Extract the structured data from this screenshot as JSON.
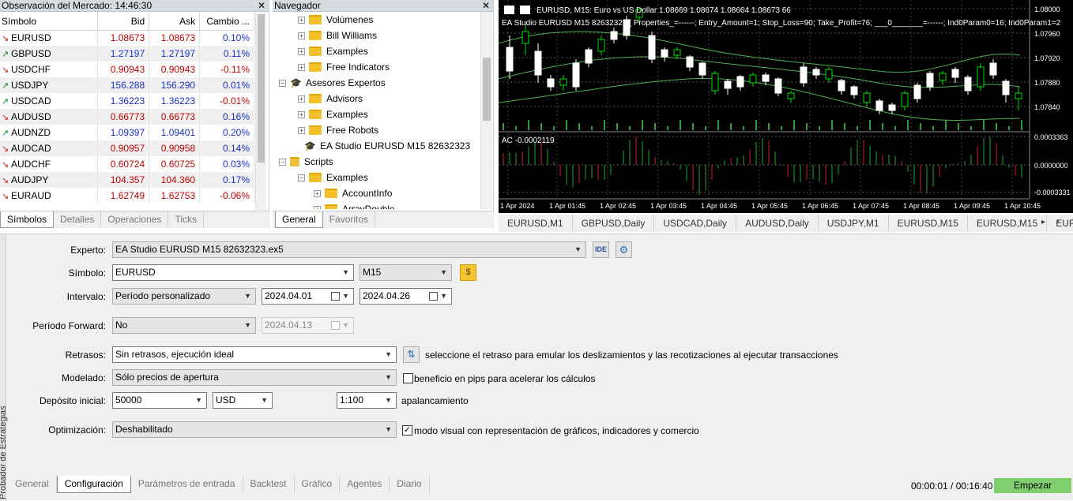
{
  "market_watch": {
    "title": "Observación del Mercado: 14:46:30",
    "columns": [
      "Símbolo",
      "Bid",
      "Ask",
      "Cambio ..."
    ],
    "rows": [
      {
        "symbol": "EURUSD",
        "bid": "1.08673",
        "ask": "1.08673",
        "change": "0.10%",
        "dir": "down"
      },
      {
        "symbol": "GBPUSD",
        "bid": "1.27197",
        "ask": "1.27197",
        "change": "0.11%",
        "dir": "up"
      },
      {
        "symbol": "USDCHF",
        "bid": "0.90943",
        "ask": "0.90943",
        "change": "-0.11%",
        "dir": "down"
      },
      {
        "symbol": "USDJPY",
        "bid": "156.288",
        "ask": "156.290",
        "change": "0.01%",
        "dir": "up"
      },
      {
        "symbol": "USDCAD",
        "bid": "1.36223",
        "ask": "1.36223",
        "change": "-0.01%",
        "dir": "up"
      },
      {
        "symbol": "AUDUSD",
        "bid": "0.66773",
        "ask": "0.66773",
        "change": "0.16%",
        "dir": "down"
      },
      {
        "symbol": "AUDNZD",
        "bid": "1.09397",
        "ask": "1.09401",
        "change": "0.20%",
        "dir": "up"
      },
      {
        "symbol": "AUDCAD",
        "bid": "0.90957",
        "ask": "0.90958",
        "change": "0.14%",
        "dir": "down"
      },
      {
        "symbol": "AUDCHF",
        "bid": "0.60724",
        "ask": "0.60725",
        "change": "0.03%",
        "dir": "down"
      },
      {
        "symbol": "AUDJPY",
        "bid": "104.357",
        "ask": "104.360",
        "change": "0.17%",
        "dir": "down"
      },
      {
        "symbol": "EURAUD",
        "bid": "1.62749",
        "ask": "1.62753",
        "change": "-0.06%",
        "dir": "down"
      }
    ],
    "tabs": [
      "Símbolos",
      "Detalles",
      "Operaciones",
      "Ticks"
    ]
  },
  "navigator": {
    "title": "Navegador",
    "items": [
      {
        "label": "Volúmenes",
        "icon": "folder-icon",
        "toggle": "+"
      },
      {
        "label": "Bill Williams",
        "icon": "folder-icon",
        "toggle": "+"
      },
      {
        "label": "Examples",
        "icon": "folder-icon",
        "toggle": "+"
      },
      {
        "label": "Free Indicators",
        "icon": "folder-icon",
        "toggle": "+"
      },
      {
        "label": "Asesores Expertos",
        "icon": "graduation-cap-icon",
        "toggle": "-"
      },
      {
        "label": "Advisors",
        "icon": "folder-icon",
        "toggle": "+"
      },
      {
        "label": "Examples",
        "icon": "folder-icon",
        "toggle": "+"
      },
      {
        "label": "Free Robots",
        "icon": "folder-icon",
        "toggle": "+"
      },
      {
        "label": "EA Studio EURUSD M15 82632323",
        "icon": "graduation-cap-icon",
        "toggle": ""
      },
      {
        "label": "Scripts",
        "icon": "script-icon",
        "toggle": "-"
      },
      {
        "label": "Examples",
        "icon": "folder-icon",
        "toggle": "-"
      },
      {
        "label": "AccountInfo",
        "icon": "folder-icon",
        "toggle": "+"
      },
      {
        "label": "ArrayDouble",
        "icon": "folder-icon",
        "toggle": "+"
      }
    ],
    "tabs": [
      "General",
      "Favoritos"
    ]
  },
  "chart": {
    "header": "EURUSD, M15:  Euro vs US Dollar  1.08669 1.08674 1.08664 1.08673  66",
    "ea_line": "EA Studio EURUSD M15 82632323  [ Properties_=------; Entry_Amount=1; Stop_Loss=90; Take_Profit=76; ___0_______=------; Ind0Param0=16; Ind0Param1=2",
    "price_labels": [
      "1.08000",
      "1.07960",
      "1.07920",
      "1.07880",
      "1.07840"
    ],
    "indicator_label": "AC -0.0002119",
    "indicator_levels": [
      "0.0003363",
      "0.0000000",
      "-0.0003331"
    ],
    "time_labels": [
      "1 Apr 2024",
      "1 Apr 01:45",
      "1 Apr 02:45",
      "1 Apr 03:45",
      "1 Apr 04:45",
      "1 Apr 05:45",
      "1 Apr 06:45",
      "1 Apr 07:45",
      "1 Apr 08:45",
      "1 Apr 09:45",
      "1 Apr 10:45"
    ],
    "bull_color": "#00e000",
    "bear_color": "#ffffff"
  },
  "chart_tabs": [
    "EURUSD,M1",
    "GBPUSD,Daily",
    "USDCAD,Daily",
    "AUDUSD,Daily",
    "USDJPY,M1",
    "EURUSD,M15",
    "EURUSD,M15",
    "EUR"
  ],
  "tester": {
    "side_label": "Probador de Estrategias",
    "labels": {
      "expert": "Experto:",
      "symbol": "Símbolo:",
      "interval": "Intervalo:",
      "forward": "Período Forward:",
      "delays": "Retrasos:",
      "model": "Modelado:",
      "deposit": "Depósito inicial:",
      "optimization": "Optimización:"
    },
    "values": {
      "expert": "EA Studio EURUSD M15 82632323.ex5",
      "ide": "IDE",
      "symbol": "EURUSD",
      "timeframe": "M15",
      "interval": "Período personalizado",
      "date_from": "2024.04.01",
      "date_to": "2024.04.26",
      "forward": "No",
      "forward_date": "2024.04.13",
      "delays": "Sin retrasos, ejecución ideal",
      "delays_hint": "seleccione el retraso para emular los deslizamientos y las recotizaciones al ejecutar transacciones",
      "model": "Sólo precios de apertura",
      "pips_hint": "beneficio en pips para acelerar los cálculos",
      "deposit": "50000",
      "currency": "USD",
      "leverage": "1:100",
      "leverage_label": "apalancamiento",
      "optimization": "Deshabilitado",
      "visual_mode": "modo visual con representación de gráficos, indicadores y comercio",
      "visual_checked": "✓"
    },
    "tabs": [
      "General",
      "Configuración",
      "Parámetros de entrada",
      "Backtest",
      "Gráfico",
      "Agentes",
      "Diario"
    ],
    "timer": "00:00:01 / 00:16:40",
    "start_label": "Empezar"
  }
}
